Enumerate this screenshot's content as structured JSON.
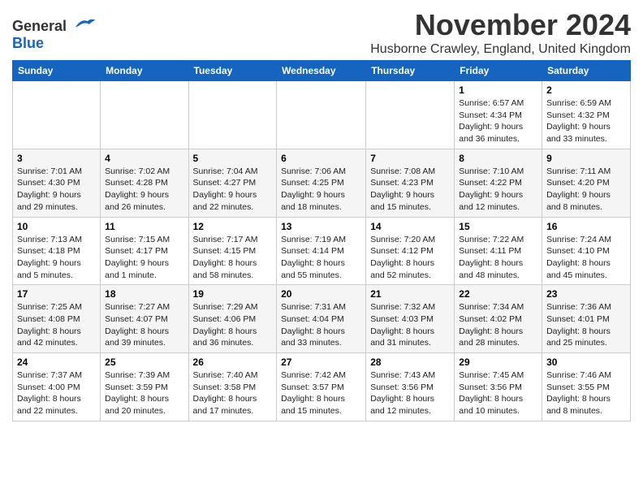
{
  "logo": {
    "general": "General",
    "blue": "Blue"
  },
  "title": {
    "month": "November 2024",
    "location": "Husborne Crawley, England, United Kingdom"
  },
  "headers": [
    "Sunday",
    "Monday",
    "Tuesday",
    "Wednesday",
    "Thursday",
    "Friday",
    "Saturday"
  ],
  "weeks": [
    [
      {
        "day": "",
        "info": ""
      },
      {
        "day": "",
        "info": ""
      },
      {
        "day": "",
        "info": ""
      },
      {
        "day": "",
        "info": ""
      },
      {
        "day": "",
        "info": ""
      },
      {
        "day": "1",
        "info": "Sunrise: 6:57 AM\nSunset: 4:34 PM\nDaylight: 9 hours and 36 minutes."
      },
      {
        "day": "2",
        "info": "Sunrise: 6:59 AM\nSunset: 4:32 PM\nDaylight: 9 hours and 33 minutes."
      }
    ],
    [
      {
        "day": "3",
        "info": "Sunrise: 7:01 AM\nSunset: 4:30 PM\nDaylight: 9 hours and 29 minutes."
      },
      {
        "day": "4",
        "info": "Sunrise: 7:02 AM\nSunset: 4:28 PM\nDaylight: 9 hours and 26 minutes."
      },
      {
        "day": "5",
        "info": "Sunrise: 7:04 AM\nSunset: 4:27 PM\nDaylight: 9 hours and 22 minutes."
      },
      {
        "day": "6",
        "info": "Sunrise: 7:06 AM\nSunset: 4:25 PM\nDaylight: 9 hours and 18 minutes."
      },
      {
        "day": "7",
        "info": "Sunrise: 7:08 AM\nSunset: 4:23 PM\nDaylight: 9 hours and 15 minutes."
      },
      {
        "day": "8",
        "info": "Sunrise: 7:10 AM\nSunset: 4:22 PM\nDaylight: 9 hours and 12 minutes."
      },
      {
        "day": "9",
        "info": "Sunrise: 7:11 AM\nSunset: 4:20 PM\nDaylight: 9 hours and 8 minutes."
      }
    ],
    [
      {
        "day": "10",
        "info": "Sunrise: 7:13 AM\nSunset: 4:18 PM\nDaylight: 9 hours and 5 minutes."
      },
      {
        "day": "11",
        "info": "Sunrise: 7:15 AM\nSunset: 4:17 PM\nDaylight: 9 hours and 1 minute."
      },
      {
        "day": "12",
        "info": "Sunrise: 7:17 AM\nSunset: 4:15 PM\nDaylight: 8 hours and 58 minutes."
      },
      {
        "day": "13",
        "info": "Sunrise: 7:19 AM\nSunset: 4:14 PM\nDaylight: 8 hours and 55 minutes."
      },
      {
        "day": "14",
        "info": "Sunrise: 7:20 AM\nSunset: 4:12 PM\nDaylight: 8 hours and 52 minutes."
      },
      {
        "day": "15",
        "info": "Sunrise: 7:22 AM\nSunset: 4:11 PM\nDaylight: 8 hours and 48 minutes."
      },
      {
        "day": "16",
        "info": "Sunrise: 7:24 AM\nSunset: 4:10 PM\nDaylight: 8 hours and 45 minutes."
      }
    ],
    [
      {
        "day": "17",
        "info": "Sunrise: 7:25 AM\nSunset: 4:08 PM\nDaylight: 8 hours and 42 minutes."
      },
      {
        "day": "18",
        "info": "Sunrise: 7:27 AM\nSunset: 4:07 PM\nDaylight: 8 hours and 39 minutes."
      },
      {
        "day": "19",
        "info": "Sunrise: 7:29 AM\nSunset: 4:06 PM\nDaylight: 8 hours and 36 minutes."
      },
      {
        "day": "20",
        "info": "Sunrise: 7:31 AM\nSunset: 4:04 PM\nDaylight: 8 hours and 33 minutes."
      },
      {
        "day": "21",
        "info": "Sunrise: 7:32 AM\nSunset: 4:03 PM\nDaylight: 8 hours and 31 minutes."
      },
      {
        "day": "22",
        "info": "Sunrise: 7:34 AM\nSunset: 4:02 PM\nDaylight: 8 hours and 28 minutes."
      },
      {
        "day": "23",
        "info": "Sunrise: 7:36 AM\nSunset: 4:01 PM\nDaylight: 8 hours and 25 minutes."
      }
    ],
    [
      {
        "day": "24",
        "info": "Sunrise: 7:37 AM\nSunset: 4:00 PM\nDaylight: 8 hours and 22 minutes."
      },
      {
        "day": "25",
        "info": "Sunrise: 7:39 AM\nSunset: 3:59 PM\nDaylight: 8 hours and 20 minutes."
      },
      {
        "day": "26",
        "info": "Sunrise: 7:40 AM\nSunset: 3:58 PM\nDaylight: 8 hours and 17 minutes."
      },
      {
        "day": "27",
        "info": "Sunrise: 7:42 AM\nSunset: 3:57 PM\nDaylight: 8 hours and 15 minutes."
      },
      {
        "day": "28",
        "info": "Sunrise: 7:43 AM\nSunset: 3:56 PM\nDaylight: 8 hours and 12 minutes."
      },
      {
        "day": "29",
        "info": "Sunrise: 7:45 AM\nSunset: 3:56 PM\nDaylight: 8 hours and 10 minutes."
      },
      {
        "day": "30",
        "info": "Sunrise: 7:46 AM\nSunset: 3:55 PM\nDaylight: 8 hours and 8 minutes."
      }
    ]
  ]
}
